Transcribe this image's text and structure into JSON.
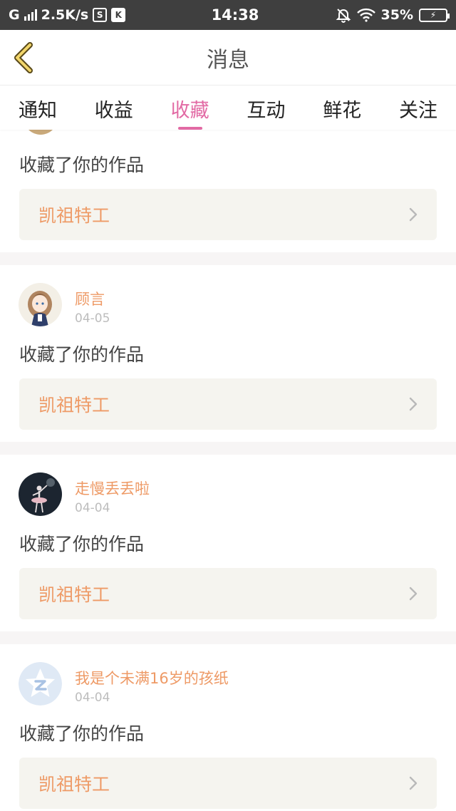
{
  "status_bar": {
    "carrier": "G",
    "speed": "2.5K/s",
    "s_icon_letter": "S",
    "k_icon_letter": "K",
    "time": "14:38",
    "battery": "35%"
  },
  "header": {
    "title": "消息"
  },
  "tabs": [
    {
      "label": "通知"
    },
    {
      "label": "收益"
    },
    {
      "label": "收藏"
    },
    {
      "label": "互动"
    },
    {
      "label": "鲜花"
    },
    {
      "label": "关注"
    }
  ],
  "active_tab": "收藏",
  "messages": [
    {
      "user": "",
      "date": "",
      "action": "收藏了你的作品",
      "work": "凯祖特工"
    },
    {
      "user": "顾言",
      "date": "04-05",
      "action": "收藏了你的作品",
      "work": "凯祖特工",
      "avatar_icon": "anime-girl-avatar"
    },
    {
      "user": "走慢丢丢啦",
      "date": "04-04",
      "action": "收藏了你的作品",
      "work": "凯祖特工",
      "avatar_icon": "ballerina-avatar"
    },
    {
      "user": "我是个未满16岁的孩纸",
      "date": "04-04",
      "action": "收藏了你的作品",
      "work": "凯祖特工",
      "avatar_icon": "default-star-avatar"
    }
  ],
  "colors": {
    "accent_pink": "#e26aa4",
    "name_orange": "#ee9a66",
    "work_bg": "#f5f4ef",
    "statusbar": "#3f3f3f"
  }
}
